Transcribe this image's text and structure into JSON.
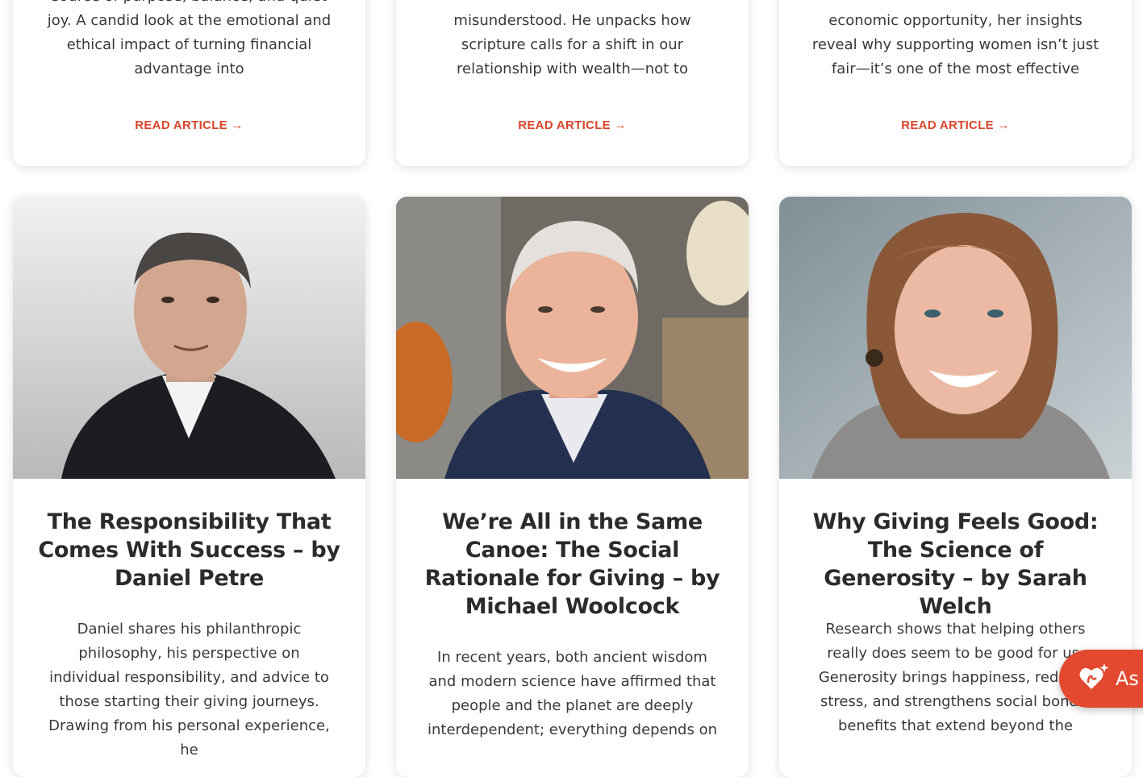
{
  "top_cards": [
    {
      "excerpt": "source of purpose, balance, and quiet joy. A candid look at the emotional and ethical impact of turning financial advantage into",
      "link": "READ ARTICLE →"
    },
    {
      "excerpt": "misunderstood. He unpacks how scripture calls for a shift in our relationship with wealth—not to",
      "link": "READ ARTICLE →"
    },
    {
      "excerpt": "economic opportunity, her insights reveal why supporting women isn’t just fair—it’s one of the most effective",
      "link": "READ ARTICLE →"
    }
  ],
  "articles": [
    {
      "title": "The Responsibility That Comes With Success – by Daniel Petre",
      "excerpt": "Daniel shares his philanthropic philosophy, his perspective on individual responsibility, and advice to those starting their giving journeys. Drawing from his personal experience, he"
    },
    {
      "title": "We’re All in the Same Canoe: The Social Rationale for Giving – by Michael Woolcock",
      "excerpt": "In recent years, both ancient wisdom and modern science have affirmed that people and the planet are deeply interdependent; everything depends on"
    },
    {
      "title": "Why Giving Feels Good: The Science of Generosity – by Sarah Welch",
      "excerpt": "Research shows that helping others really does seem to be good for us. Generosity brings happiness, reduces stress, and strengthens social bonds, benefits that extend beyond the"
    }
  ],
  "assistant_button": {
    "label": "As",
    "icon": "heart-hand-sparkle-icon",
    "color": "#e2492f"
  },
  "colors": {
    "accent": "#d9452b",
    "text": "#2e2e2e"
  }
}
